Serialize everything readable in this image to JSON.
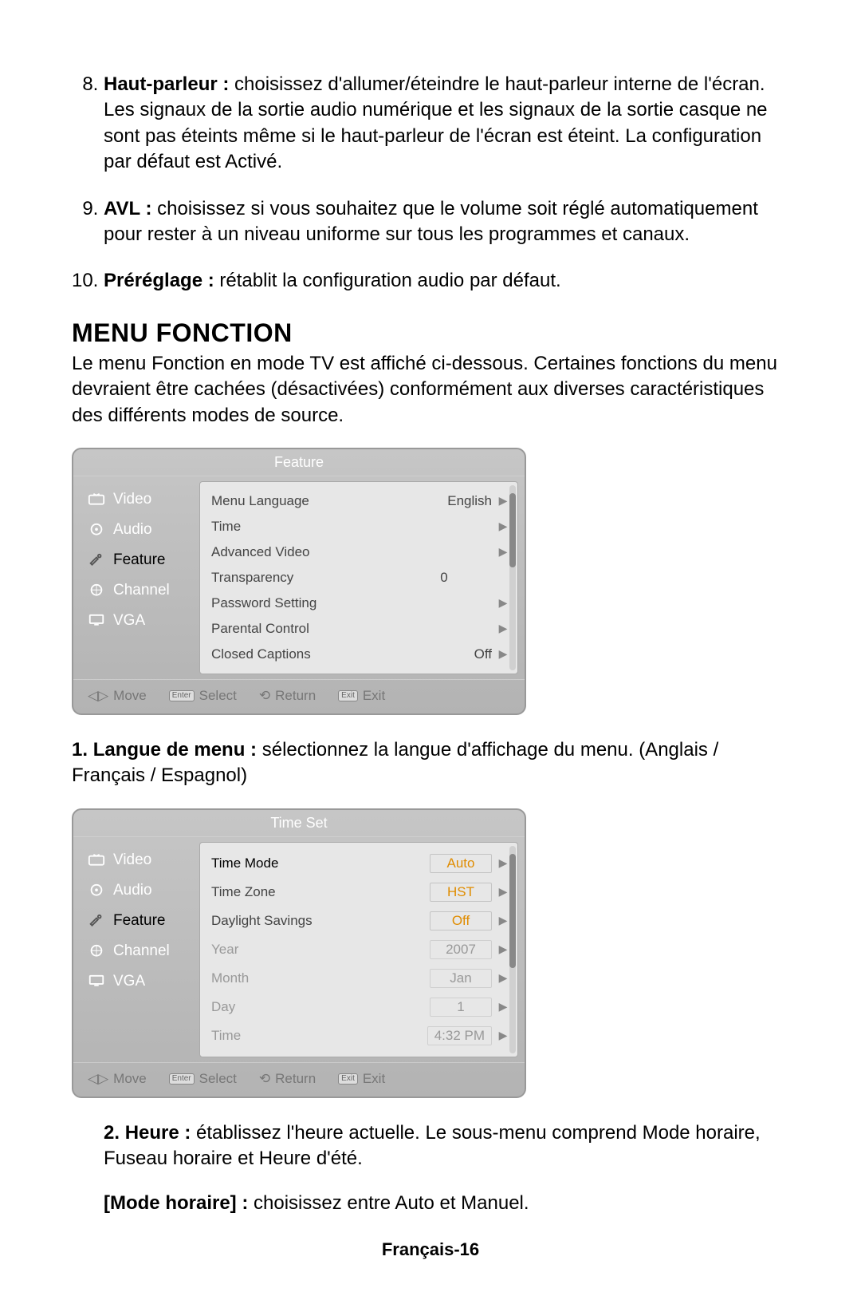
{
  "list_items": {
    "i8": {
      "num": "8.",
      "head": "Haut-parleur :",
      "text": " choisissez d'allumer/éteindre le haut-parleur interne de l'écran. Les signaux de la sortie audio numérique et les signaux de la sortie casque ne sont pas éteints même si le haut-parleur de l'écran est éteint. La configuration par défaut est Activé."
    },
    "i9": {
      "num": "9.",
      "head": "AVL :",
      "text": " choisissez si vous souhaitez que le volume soit réglé automatiquement pour rester à un niveau uniforme sur tous les programmes et canaux."
    },
    "i10": {
      "num": "10.",
      "head": "Préréglage :",
      "text": " rétablit la configuration audio par défaut."
    }
  },
  "section": {
    "title": "MENU FONCTION",
    "desc": "Le menu Fonction en mode TV est affiché ci-dessous. Certaines fonctions du menu devraient être cachées (désactivées) conformément aux diverses caractéristiques des différents modes de source."
  },
  "after": {
    "a1": {
      "num": "1.",
      "head": "Langue de menu :",
      "text": " sélectionnez la langue d'affichage du menu. (Anglais / Français / Espagnol)"
    },
    "a2": {
      "num": "2.",
      "head": "Heure :",
      "text": " établissez l'heure actuelle. Le sous-menu comprend Mode horaire, Fuseau horaire et Heure d'été."
    },
    "a3": {
      "head": "[Mode horaire] :",
      "text": " choisissez entre Auto et Manuel."
    }
  },
  "osd1": {
    "title": "Feature",
    "sidebar": [
      "Video",
      "Audio",
      "Feature",
      "Channel",
      "VGA"
    ],
    "rows": [
      {
        "label": "Menu Language",
        "value": "English",
        "arrow": true
      },
      {
        "label": "Time",
        "value": "",
        "arrow": true
      },
      {
        "label": "Advanced Video",
        "value": "",
        "arrow": true
      },
      {
        "label": "Transparency",
        "value": "0",
        "arrow": false
      },
      {
        "label": "Password Setting",
        "value": "",
        "arrow": true
      },
      {
        "label": "Parental Control",
        "value": "",
        "arrow": true
      },
      {
        "label": "Closed Captions",
        "value": "Off",
        "arrow": true
      }
    ],
    "footer": {
      "move": "Move",
      "select": "Select",
      "return_": "Return",
      "exit": "Exit",
      "enter": "Enter",
      "exitkey": "Exit"
    }
  },
  "osd2": {
    "title": "Time Set",
    "sidebar": [
      "Video",
      "Audio",
      "Feature",
      "Channel",
      "VGA"
    ],
    "rows": [
      {
        "label": "Time Mode",
        "value": "Auto",
        "arrow": true,
        "cls": "active-black",
        "box": true
      },
      {
        "label": "Time Zone",
        "value": "HST",
        "arrow": true,
        "box": true
      },
      {
        "label": "Daylight Savings",
        "value": "Off",
        "arrow": true,
        "box": true
      },
      {
        "label": "Year",
        "value": "2007",
        "arrow": true,
        "cls": "grey",
        "box": true,
        "greybox": true
      },
      {
        "label": "Month",
        "value": "Jan",
        "arrow": true,
        "cls": "grey",
        "box": true,
        "greybox": true
      },
      {
        "label": "Day",
        "value": "1",
        "arrow": true,
        "cls": "grey",
        "box": true,
        "greybox": true
      },
      {
        "label": "Time",
        "value": "4:32 PM",
        "arrow": true,
        "cls": "grey",
        "box": true,
        "greybox": true
      }
    ],
    "footer": {
      "move": "Move",
      "select": "Select",
      "return_": "Return",
      "exit": "Exit",
      "enter": "Enter",
      "exitkey": "Exit"
    }
  },
  "page_footer": "Français-16"
}
